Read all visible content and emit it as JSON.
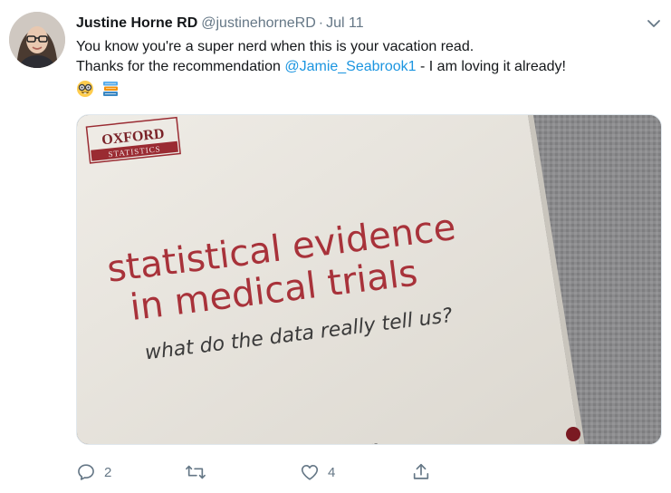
{
  "tweet": {
    "author": {
      "display_name": "Justine Horne RD",
      "handle": "@justinehorneRD",
      "separator": "·",
      "date": "Jul 11"
    },
    "text": {
      "line1": "You know you're a super nerd when this is your vacation read.",
      "line2_before": "Thanks for the recommendation ",
      "mention": "@Jamie_Seabrook1",
      "line2_after": " - I am loving it already!"
    },
    "emojis": [
      "nerd-face",
      "books"
    ],
    "media": {
      "publisher_name": "OXFORD",
      "publisher_series": "STATISTICS",
      "book_title_line1": "statistical evidence",
      "book_title_line2": "in medical trials",
      "book_subtitle": "what do the data really tell us?",
      "author_fragment": "imon"
    },
    "actions": {
      "reply_count": "2",
      "retweet_count": "",
      "like_count": "4"
    },
    "icons": {
      "caret": "chevron-down-icon",
      "reply": "reply-icon",
      "retweet": "retweet-icon",
      "like": "heart-icon",
      "share": "share-icon"
    },
    "colors": {
      "text": "#14171a",
      "secondary": "#657786",
      "link": "#1b95e0",
      "book_title": "#a8323a"
    }
  }
}
